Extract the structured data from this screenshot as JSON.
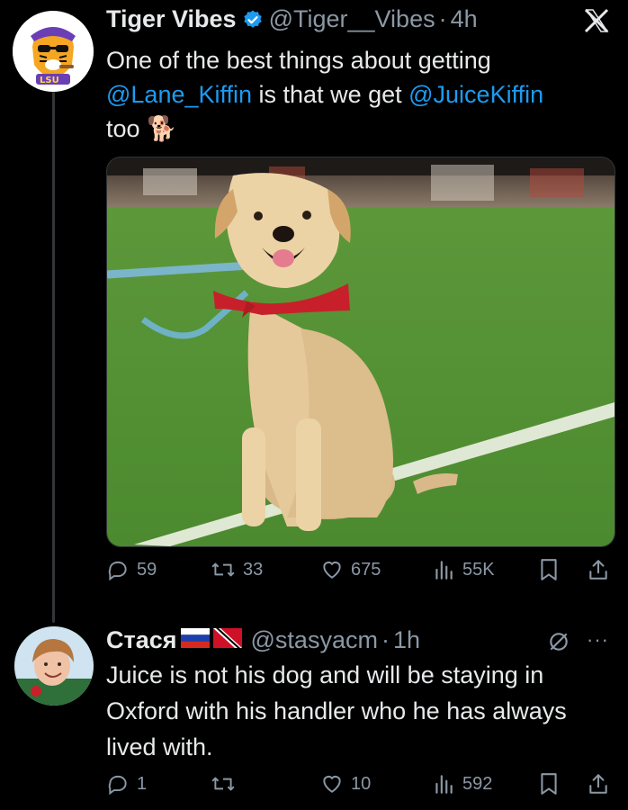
{
  "tweet": {
    "display_name": "Tiger Vibes",
    "handle": "@Tiger__Vibes",
    "separator": "·",
    "time": "4h",
    "avatar_text": "LSU",
    "text_part1": "One of the best things about getting",
    "mention1": "@Lane_Kiffin",
    "text_part2": " is that we get ",
    "mention2": "@JuiceKiffin",
    "text_part3": "too",
    "emoji": "🐕",
    "stats": {
      "replies": "59",
      "reposts": "33",
      "likes": "675",
      "views": "55K"
    }
  },
  "reply": {
    "display_name": "Стася",
    "handle": "@stasyacm",
    "separator": "·",
    "time": "1h",
    "more": "···",
    "text": "Juice is not his dog and will be staying in Oxford with his handler who he has always lived with.",
    "stats": {
      "replies": "1",
      "reposts": "",
      "likes": "10",
      "views": "592"
    }
  },
  "icons": {
    "verified": "verified-badge-icon",
    "x_logo": "x-logo-icon",
    "reply": "reply-icon",
    "repost": "repost-icon",
    "like": "like-icon",
    "views": "views-icon",
    "bookmark": "bookmark-icon",
    "share": "share-icon",
    "grok": "grok-icon"
  },
  "colors": {
    "background": "#000000",
    "text": "#e7e9ea",
    "secondary": "#8b98a5",
    "link": "#1d9bf0",
    "verified": "#1d9bf0"
  }
}
